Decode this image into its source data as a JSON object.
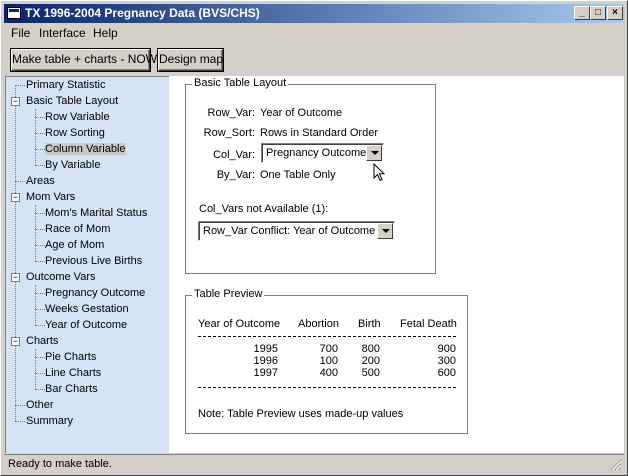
{
  "window": {
    "title": "TX 1996-2004 Pregnancy Data (BVS/CHS)",
    "controls": [
      "_",
      "□",
      "×"
    ]
  },
  "menu": [
    "File",
    "Interface",
    "Help"
  ],
  "toolbar": {
    "make_label": "Make table + charts - NOW",
    "map_label": "Design map"
  },
  "tree": [
    {
      "label": "Primary Statistic"
    },
    {
      "label": "Basic Table Layout",
      "expander": "−"
    },
    {
      "label": "Row Variable"
    },
    {
      "label": "Row Sorting"
    },
    {
      "label": "Column Variable",
      "selected": true
    },
    {
      "label": "By Variable"
    },
    {
      "label": "Areas"
    },
    {
      "label": "Mom Vars",
      "expander": "−"
    },
    {
      "label": "Mom's Marital Status"
    },
    {
      "label": "Race of Mom"
    },
    {
      "label": "Age of Mom"
    },
    {
      "label": "Previous Live Births"
    },
    {
      "label": "Outcome Vars",
      "expander": "−"
    },
    {
      "label": "Pregnancy Outcome"
    },
    {
      "label": "Weeks Gestation"
    },
    {
      "label": "Year of Outcome"
    },
    {
      "label": "Charts",
      "expander": "−"
    },
    {
      "label": "Pie Charts"
    },
    {
      "label": "Line Charts"
    },
    {
      "label": "Bar Charts"
    },
    {
      "label": "Other"
    },
    {
      "label": "Summary"
    }
  ],
  "layout_group": {
    "title": "Basic Table Layout",
    "row_var_label": "Row_Var:",
    "row_var_value": "Year of Outcome",
    "row_sort_label": "Row_Sort:",
    "row_sort_value": "Rows in Standard Order",
    "col_var_label": "Col_Var:",
    "col_var_value": "Pregnancy Outcome",
    "by_var_label": "By_Var:",
    "by_var_value": "One Table Only",
    "not_available_label": "Col_Vars not Available (1):",
    "not_available_value": "Row_Var Conflict: Year of Outcome"
  },
  "preview": {
    "title": "Table Preview",
    "headers": [
      "Year of Outcome",
      "Abortion",
      "Birth",
      "Fetal Death"
    ],
    "rows": [
      [
        "1995",
        "700",
        "800",
        "900"
      ],
      [
        "1996",
        "100",
        "200",
        "300"
      ],
      [
        "1997",
        "400",
        "500",
        "600"
      ]
    ],
    "note": "Note: Table Preview uses made-up values"
  },
  "status": "Ready to make table.",
  "colors": {
    "titlebar_start": "#0a246a",
    "titlebar_end": "#a6caf0",
    "tree_bg": "#d6e3f5",
    "face": "#d4d0c8"
  }
}
